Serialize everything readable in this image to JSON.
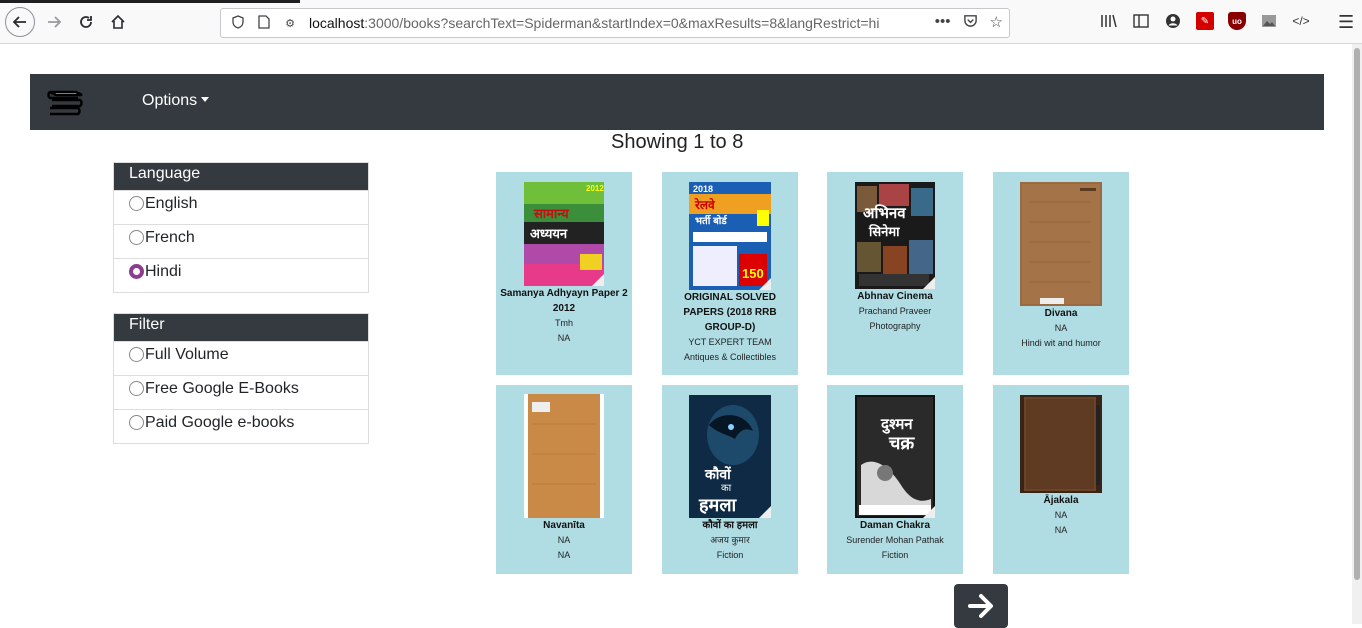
{
  "browser": {
    "url_host": "localhost",
    "url_rest": ":3000/books?searchText=Spiderman&startIndex=0&maxResults=8&langRestrict=hi"
  },
  "navbar": {
    "options_label": "Options"
  },
  "results": {
    "showing": "Showing 1 to 8"
  },
  "language_panel": {
    "title": "Language",
    "items": [
      {
        "label": "English",
        "checked": false
      },
      {
        "label": "French",
        "checked": false
      },
      {
        "label": "Hindi",
        "checked": true
      }
    ]
  },
  "filter_panel": {
    "title": "Filter",
    "items": [
      {
        "label": "Full Volume",
        "checked": false
      },
      {
        "label": "Free Google E-Books",
        "checked": false
      },
      {
        "label": "Paid Google e-books",
        "checked": false
      }
    ]
  },
  "books": [
    {
      "title": "Samanya Adhyayn Paper 2 2012",
      "author": "Tmh",
      "category": "NA"
    },
    {
      "title": "ORIGINAL SOLVED PAPERS (2018 RRB GROUP-D)",
      "author": "YCT EXPERT TEAM",
      "category": "Antiques & Collectibles"
    },
    {
      "title": "Abhnav Cinema",
      "author": "Prachand Praveer",
      "category": "Photography"
    },
    {
      "title": "Divana",
      "author": "NA",
      "category": "Hindi wit and humor"
    },
    {
      "title": "Navanīta",
      "author": "NA",
      "category": "NA"
    },
    {
      "title": "कौवों का हमला",
      "author": "अजय कुमार",
      "category": "Fiction"
    },
    {
      "title": "Daman Chakra",
      "author": "Surender Mohan Pathak",
      "category": "Fiction"
    },
    {
      "title": "Ājakala",
      "author": "NA",
      "category": "NA"
    }
  ],
  "cover_text": {
    "book1_year": "2012",
    "book1_line1": "सामान्य",
    "book1_line2": "अध्ययन",
    "book2_year": "2018",
    "book2_line1": "रेलवे",
    "book2_line2": "भर्ती बोर्ड",
    "book2_total": "150",
    "book3_line1": "अभिनव",
    "book3_line2": "सिनेमा",
    "book6_line1": "कौवों",
    "book6_line2": "का",
    "book6_line3": "हमला",
    "book7_line1": "दुश्मन",
    "book7_line2": "चक्र"
  }
}
